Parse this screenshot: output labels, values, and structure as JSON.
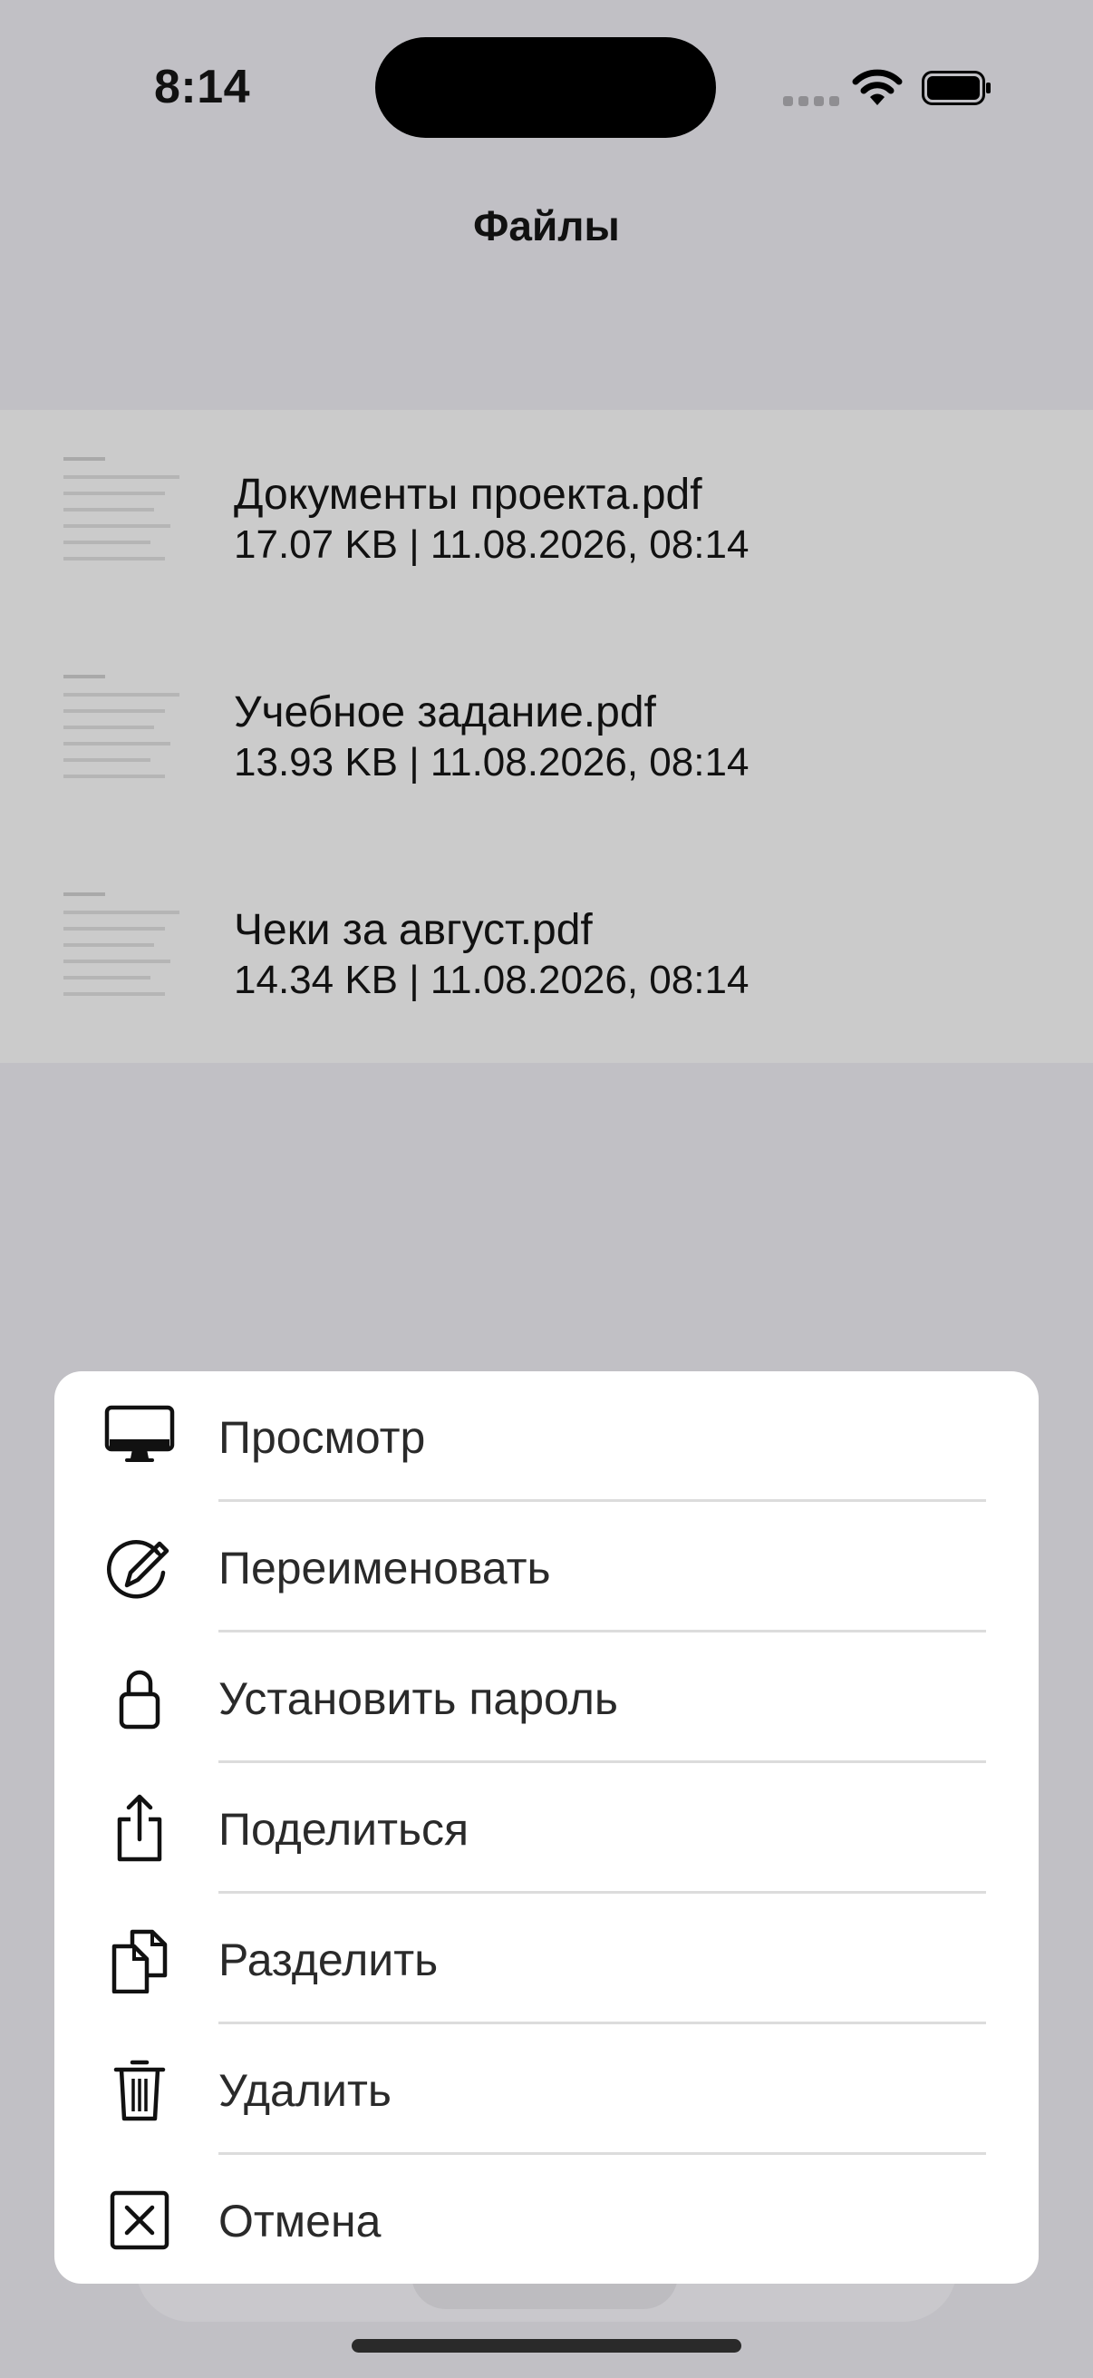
{
  "status_bar": {
    "time": "8:14",
    "icons": [
      "signal-icon",
      "wifi-icon",
      "battery-icon"
    ]
  },
  "nav": {
    "title": "Файлы"
  },
  "files": [
    {
      "name": "Документы проекта.pdf",
      "meta": "17.07 KB | 11.08.2026, 08:14",
      "icon": "pdf-thumbnail-icon"
    },
    {
      "name": "Учебное задание.pdf",
      "meta": "13.93 KB | 11.08.2026, 08:14",
      "icon": "pdf-thumbnail-icon"
    },
    {
      "name": "Чеки за август.pdf",
      "meta": "14.34 KB | 11.08.2026, 08:14",
      "icon": "pdf-thumbnail-icon"
    }
  ],
  "action_sheet": {
    "items": [
      {
        "label": "Просмотр",
        "icon": "monitor-icon"
      },
      {
        "label": "Переименовать",
        "icon": "rename-icon"
      },
      {
        "label": "Установить пароль",
        "icon": "lock-icon"
      },
      {
        "label": "Поделиться",
        "icon": "share-icon"
      },
      {
        "label": "Разделить",
        "icon": "split-documents-icon"
      },
      {
        "label": "Удалить",
        "icon": "trash-icon"
      },
      {
        "label": "Отмена",
        "icon": "close-box-icon"
      }
    ]
  },
  "colors": {
    "background_dim": "#c1c0c5",
    "list_background": "#cbcbcb",
    "sheet_background": "#ffffff",
    "text": "#111111"
  }
}
